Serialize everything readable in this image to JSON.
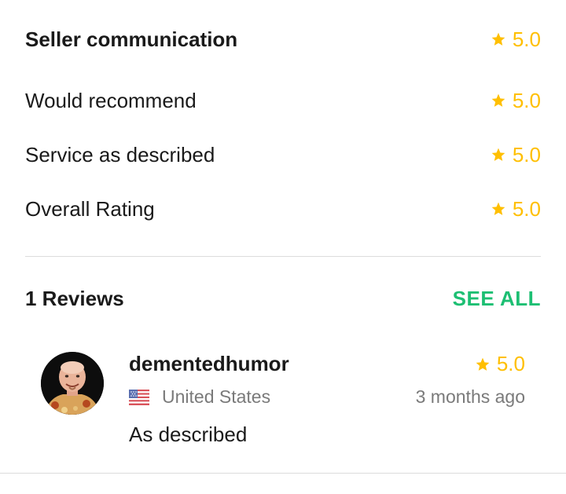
{
  "ratings": [
    {
      "label": "Seller communication",
      "score": "5.0"
    },
    {
      "label": "Would recommend",
      "score": "5.0"
    },
    {
      "label": "Service as described",
      "score": "5.0"
    },
    {
      "label": "Overall Rating",
      "score": "5.0"
    }
  ],
  "reviews_section": {
    "title": "1 Reviews",
    "see_all_label": "SEE ALL"
  },
  "review": {
    "username": "dementedhumor",
    "score": "5.0",
    "country": "United States",
    "time_ago": "3 months ago",
    "text": "As described",
    "flag_icon": "us-flag-icon",
    "avatar_icon": "user-avatar"
  },
  "colors": {
    "star": "#ffbf00",
    "accent": "#1dbf73",
    "muted_text": "#7a7a7a",
    "divider": "#dcdcdc"
  }
}
